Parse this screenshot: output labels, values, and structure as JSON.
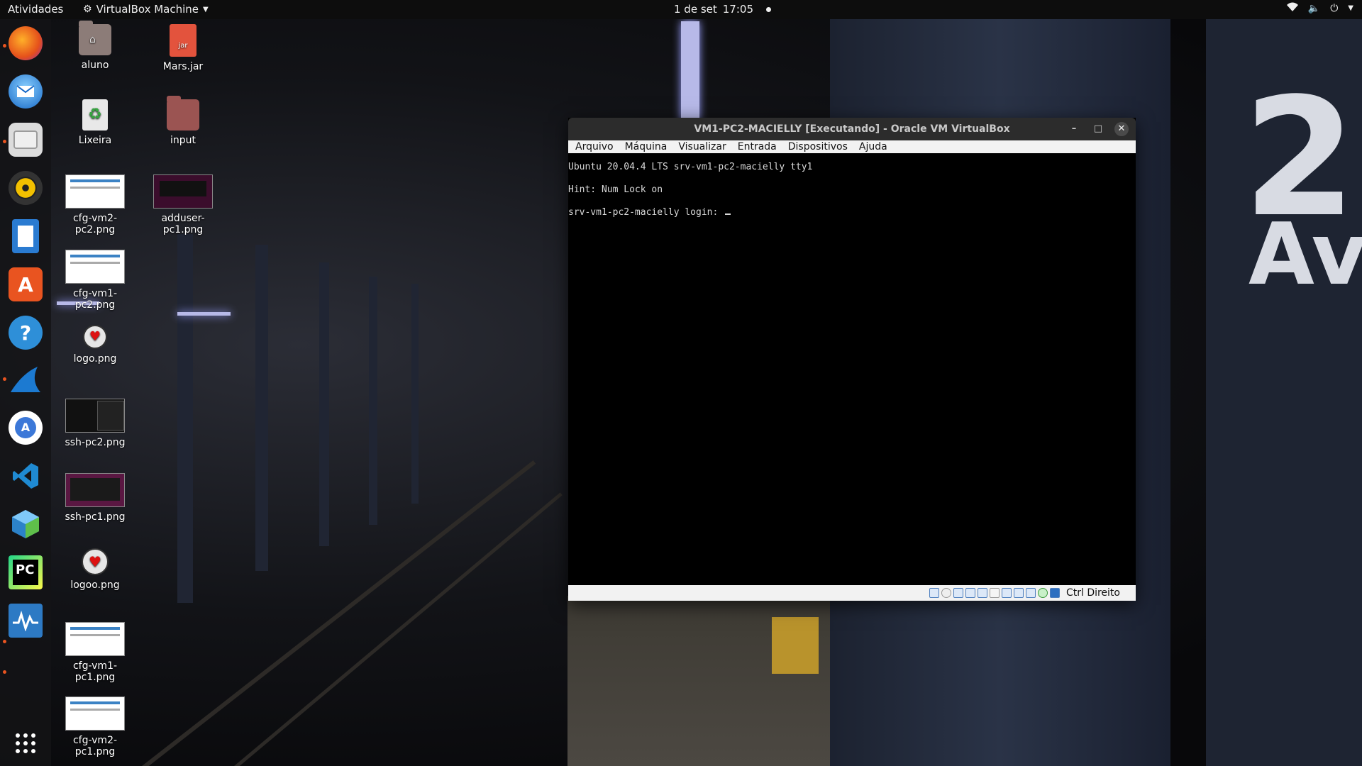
{
  "topbar": {
    "activities": "Atividades",
    "app_name": "VirtualBox Machine",
    "date": "1 de set",
    "time": "17:05"
  },
  "dock": {
    "items": [
      "firefox-icon",
      "thunderbird-icon",
      "files-icon",
      "rhythmbox-icon",
      "libreoffice-writer-icon",
      "ubuntu-software-icon",
      "help-icon",
      "wireshark-icon",
      "android-studio-icon",
      "vscode-icon",
      "virtualbox-icon",
      "pycharm-icon",
      "system-monitor-icon",
      "show-apps-icon"
    ]
  },
  "desktop": {
    "icons": [
      {
        "label": "aluno"
      },
      {
        "label": "Mars.jar"
      },
      {
        "label": "Lixeira"
      },
      {
        "label": "input"
      },
      {
        "label": "cfg-vm2-pc2.png"
      },
      {
        "label": "adduser-pc1.png"
      },
      {
        "label": "cfg-vm1-pc2.png"
      },
      {
        "label": "logo.png"
      },
      {
        "label": "ssh-pc2.png"
      },
      {
        "label": "ssh-pc1.png"
      },
      {
        "label": "logoo.png"
      },
      {
        "label": "cfg-vm1-pc1.png"
      },
      {
        "label": "cfg-vm2-pc1.png"
      }
    ]
  },
  "vbox": {
    "title": "VM1-PC2-MACIELLY [Executando] - Oracle VM VirtualBox",
    "menu": [
      "Arquivo",
      "Máquina",
      "Visualizar",
      "Entrada",
      "Dispositivos",
      "Ajuda"
    ],
    "terminal": [
      "Ubuntu 20.04.4 LTS srv-vm1-pc2-macielly tty1",
      "Hint: Num Lock on",
      "srv-vm1-pc2-macielly login: "
    ],
    "host_key": "Ctrl Direito"
  },
  "wallpaper": {
    "sign_number": "2",
    "sign_text": "Av"
  }
}
